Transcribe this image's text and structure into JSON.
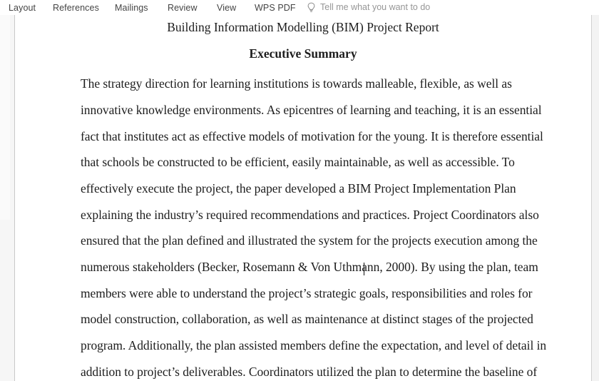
{
  "ribbon": {
    "tabs": [
      {
        "id": "layout",
        "label": "Layout"
      },
      {
        "id": "references",
        "label": "References"
      },
      {
        "id": "mailings",
        "label": "Mailings"
      },
      {
        "id": "review",
        "label": "Review"
      },
      {
        "id": "view",
        "label": "View"
      },
      {
        "id": "wps_pdf",
        "label": "WPS PDF"
      }
    ],
    "tell_me": {
      "icon": "lightbulb-icon",
      "placeholder": "Tell me what you want to do",
      "value": ""
    }
  },
  "document": {
    "title": "Building Information Modelling (BIM) Project Report",
    "heading": "Executive Summary",
    "body_lines": [
      "The strategy direction for learning institutions is towards malleable, flexible, as well as",
      "innovative knowledge environments. As epicentres of learning and teaching, it is an essential",
      "fact that institutes act as effective models of motivation for the young. It is therefore essential",
      "that schools be constructed to be efficient, easily maintainable, as well as accessible. To",
      "effectively execute the project, the paper developed a BIM Project Implementation Plan",
      "explaining the industry’s required recommendations and practices.  Project Coordinators also",
      "ensured that the plan defined and illustrated the system for the projects execution among the",
      "numerous stakeholders (Becker, Rosemann & Von Uthmann, 2000). By using the plan, team",
      "members were able to understand the project’s strategic goals, responsibilities and roles for",
      "model construction, collaboration, as well as maintenance at distinct stages of the projected",
      "program. Additionally, the plan assisted members define the expectation, and level of detail in",
      "addition to project’s deliverables. Coordinators utilized the plan to determine the baseline of"
    ]
  },
  "colors": {
    "page_background": "#ffffff",
    "canvas_background": "#f3f3f3",
    "tab_text": "#444444",
    "placeholder_text": "#969696",
    "body_text": "#1d1d1d"
  }
}
